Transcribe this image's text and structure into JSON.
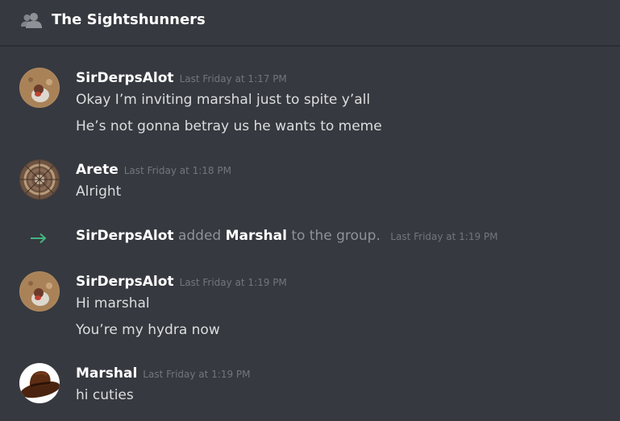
{
  "header": {
    "title": "The Sightshunners",
    "icon": "group-people-icon"
  },
  "messages": [
    {
      "author": "SirDerpsAlot",
      "timestamp": "Last Friday at 1:17 PM",
      "lines": [
        "Okay I’m inviting marshal just to spite y’all",
        "He’s not gonna betray us he wants to meme"
      ]
    },
    {
      "author": "Arete",
      "timestamp": "Last Friday at 1:18 PM",
      "lines": [
        "Alright"
      ]
    },
    {
      "author": "SirDerpsAlot",
      "timestamp": "Last Friday at 1:19 PM",
      "lines": [
        "Hi marshal",
        "You’re my hydra now"
      ]
    },
    {
      "author": "Marshal",
      "timestamp": "Last Friday at 1:19 PM",
      "lines": [
        "hi cuties"
      ]
    }
  ],
  "system": {
    "actor": "SirDerpsAlot",
    "verb": "added",
    "target": "Marshal",
    "suffix": "to the group.",
    "timestamp": "Last Friday at 1:19 PM",
    "icon": "arrow-right-icon",
    "color": "#43b581"
  },
  "colors": {
    "background": "#36393f",
    "username": "#ffffff",
    "message_text": "#dcddde",
    "timestamp": "#72767d",
    "system_text": "#8e9297",
    "join_arrow": "#43b581"
  }
}
